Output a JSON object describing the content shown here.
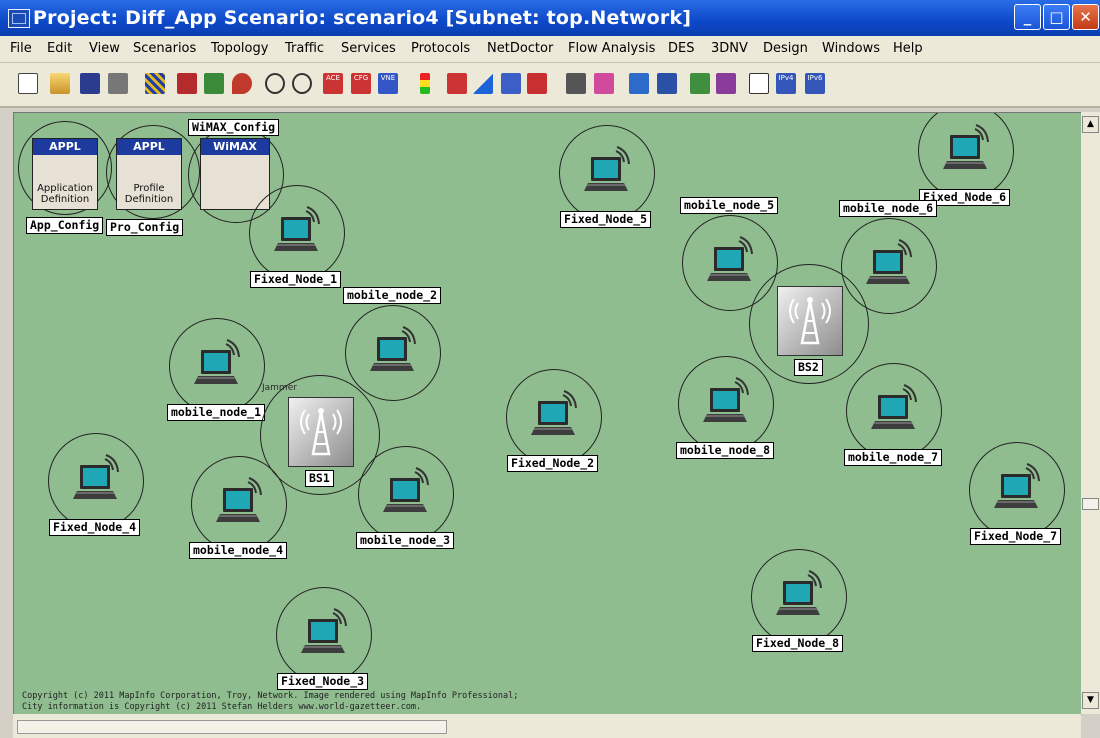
{
  "window": {
    "title": "Project: Diff_App Scenario: scenario4  [Subnet: top.Network]",
    "controls": [
      "_",
      "□",
      "✕"
    ]
  },
  "menu": [
    "File",
    "Edit",
    "View",
    "Scenarios",
    "Topology",
    "Traffic",
    "Services",
    "Protocols",
    "NetDoctor",
    "Flow Analysis",
    "DES",
    "3DNV",
    "Design",
    "Windows",
    "Help"
  ],
  "toolbar": {
    "icons": [
      "new-icon",
      "open-icon",
      "save-icon",
      "print-icon",
      "topology-icon",
      "fail-node-icon",
      "recover-node-icon",
      "node-marker-icon",
      "zoom-in-icon",
      "zoom-out-icon",
      "ace-import-icon",
      "cfg-import-icon",
      "vne-import-icon",
      "traffic-light-icon",
      "object-palette-icon",
      "mountain-icon",
      "link-config-icon",
      "link-failure-icon",
      "path-icon",
      "wizard-icon",
      "globe-icon",
      "calc-icon",
      "chart-icon",
      "graph-icon",
      "report-icon",
      "ipv6-icon",
      "ipv6-scenario-icon"
    ],
    "badges": {
      "ace": "ACE",
      "cfg": "CFG",
      "vne": "VNE",
      "ipv4": "IPv4",
      "ipv6": "IPv6"
    }
  },
  "config_objects": [
    {
      "name": "App_Config",
      "header": "APPL",
      "sub": "Application Definition"
    },
    {
      "name": "Pro_Config",
      "header": "APPL",
      "sub": "Profile Definition"
    },
    {
      "name": "WiMAX_Config",
      "header": "WiMAX",
      "sub": ""
    }
  ],
  "nodes": [
    {
      "name": "Fixed_Node_1",
      "kind": "laptop"
    },
    {
      "name": "Fixed_Node_2",
      "kind": "laptop"
    },
    {
      "name": "Fixed_Node_3",
      "kind": "laptop"
    },
    {
      "name": "Fixed_Node_4",
      "kind": "laptop"
    },
    {
      "name": "Fixed_Node_5",
      "kind": "laptop"
    },
    {
      "name": "Fixed_Node_6",
      "kind": "laptop"
    },
    {
      "name": "Fixed_Node_7",
      "kind": "laptop"
    },
    {
      "name": "Fixed_Node_8",
      "kind": "laptop"
    },
    {
      "name": "mobile_node_1",
      "kind": "laptop"
    },
    {
      "name": "mobile_node_2",
      "kind": "laptop"
    },
    {
      "name": "mobile_node_3",
      "kind": "laptop"
    },
    {
      "name": "mobile_node_4",
      "kind": "laptop"
    },
    {
      "name": "mobile_node_5",
      "kind": "laptop"
    },
    {
      "name": "mobile_node_6",
      "kind": "laptop"
    },
    {
      "name": "mobile_node_7",
      "kind": "laptop"
    },
    {
      "name": "mobile_node_8",
      "kind": "laptop"
    },
    {
      "name": "BS1",
      "kind": "base-station"
    },
    {
      "name": "BS2",
      "kind": "base-station"
    }
  ],
  "jammer_label": "Jammer",
  "copyright": {
    "line1": "Copyright (c) 2011 MapInfo Corporation, Troy, Network. Image rendered using MapInfo Professional;",
    "line2": "City information is Copyright (c) 2011 Stefan Helders www.world-gazetteer.com."
  },
  "colors": {
    "workspace": "#90bd90",
    "titlebar": "#0c48c8",
    "label_bg": "#ffffff",
    "config_header": "#1d3a9e"
  }
}
